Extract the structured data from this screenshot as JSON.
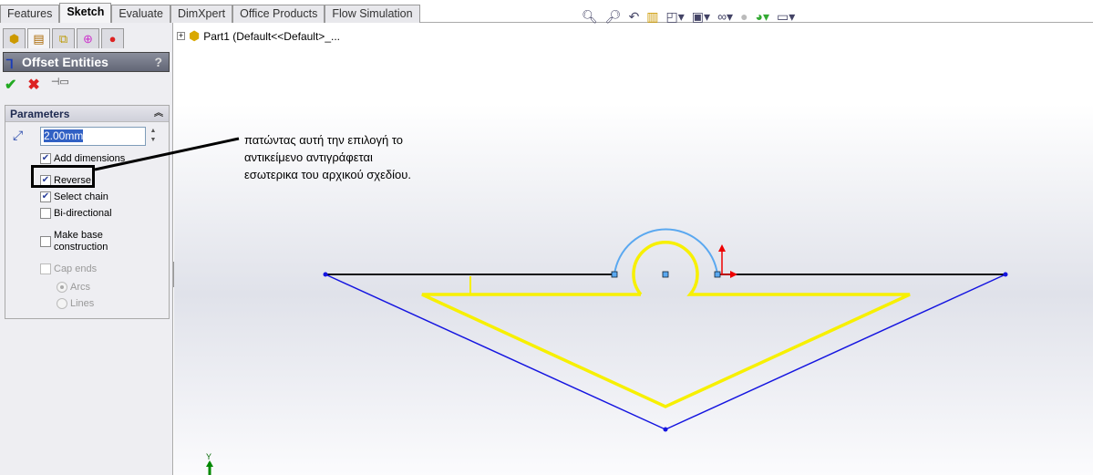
{
  "command_tabs": [
    "Features",
    "Sketch",
    "Evaluate",
    "DimXpert",
    "Office Products",
    "Flow Simulation"
  ],
  "active_tab": "Sketch",
  "panel_tabs": [
    "feature-manager-icon",
    "property-manager-icon",
    "configuration-manager-icon",
    "dimxpert-manager-icon",
    "display-manager-icon"
  ],
  "property_manager": {
    "title": "Offset Entities",
    "help": "?",
    "ok": "✔",
    "cancel": "✖",
    "pin": "⊣▭",
    "group_title": "Parameters",
    "distance": "2.00mm",
    "options": [
      {
        "label": "Add dimensions",
        "checked": true,
        "enabled": true
      },
      {
        "label": "Reverse",
        "checked": true,
        "enabled": true
      },
      {
        "label": "Select chain",
        "checked": true,
        "enabled": true
      },
      {
        "label": "Bi-directional",
        "checked": false,
        "enabled": true
      },
      {
        "label": "Make base construction",
        "checked": false,
        "enabled": true
      },
      {
        "label": "Cap ends",
        "checked": false,
        "enabled": false
      }
    ],
    "cap_types": [
      {
        "label": "Arcs",
        "selected": true
      },
      {
        "label": "Lines",
        "selected": false
      }
    ]
  },
  "tree": {
    "label": "Part1  (Default<<Default>_..."
  },
  "view_toolbar": [
    "zoom-to-fit-icon",
    "zoom-to-area-icon",
    "previous-view-icon",
    "section-view-icon",
    "view-orientation-icon",
    "display-style-icon",
    "hide-show-items-icon",
    "edit-appearance-icon",
    "apply-scene-icon",
    "view-settings-icon"
  ],
  "annotation": {
    "lines": [
      "πατώντας αυτή την επιλογή το",
      "αντικείμενο αντιγράφεται",
      "εσωτερικα του αρχικού σχεδίου."
    ]
  },
  "triad_label": "Y",
  "colors": {
    "original_sketch": "#1515e0",
    "offset_sketch": "#f7f000",
    "arc": "#5aa8f0",
    "line": "#111111",
    "origin": "#e00000"
  }
}
